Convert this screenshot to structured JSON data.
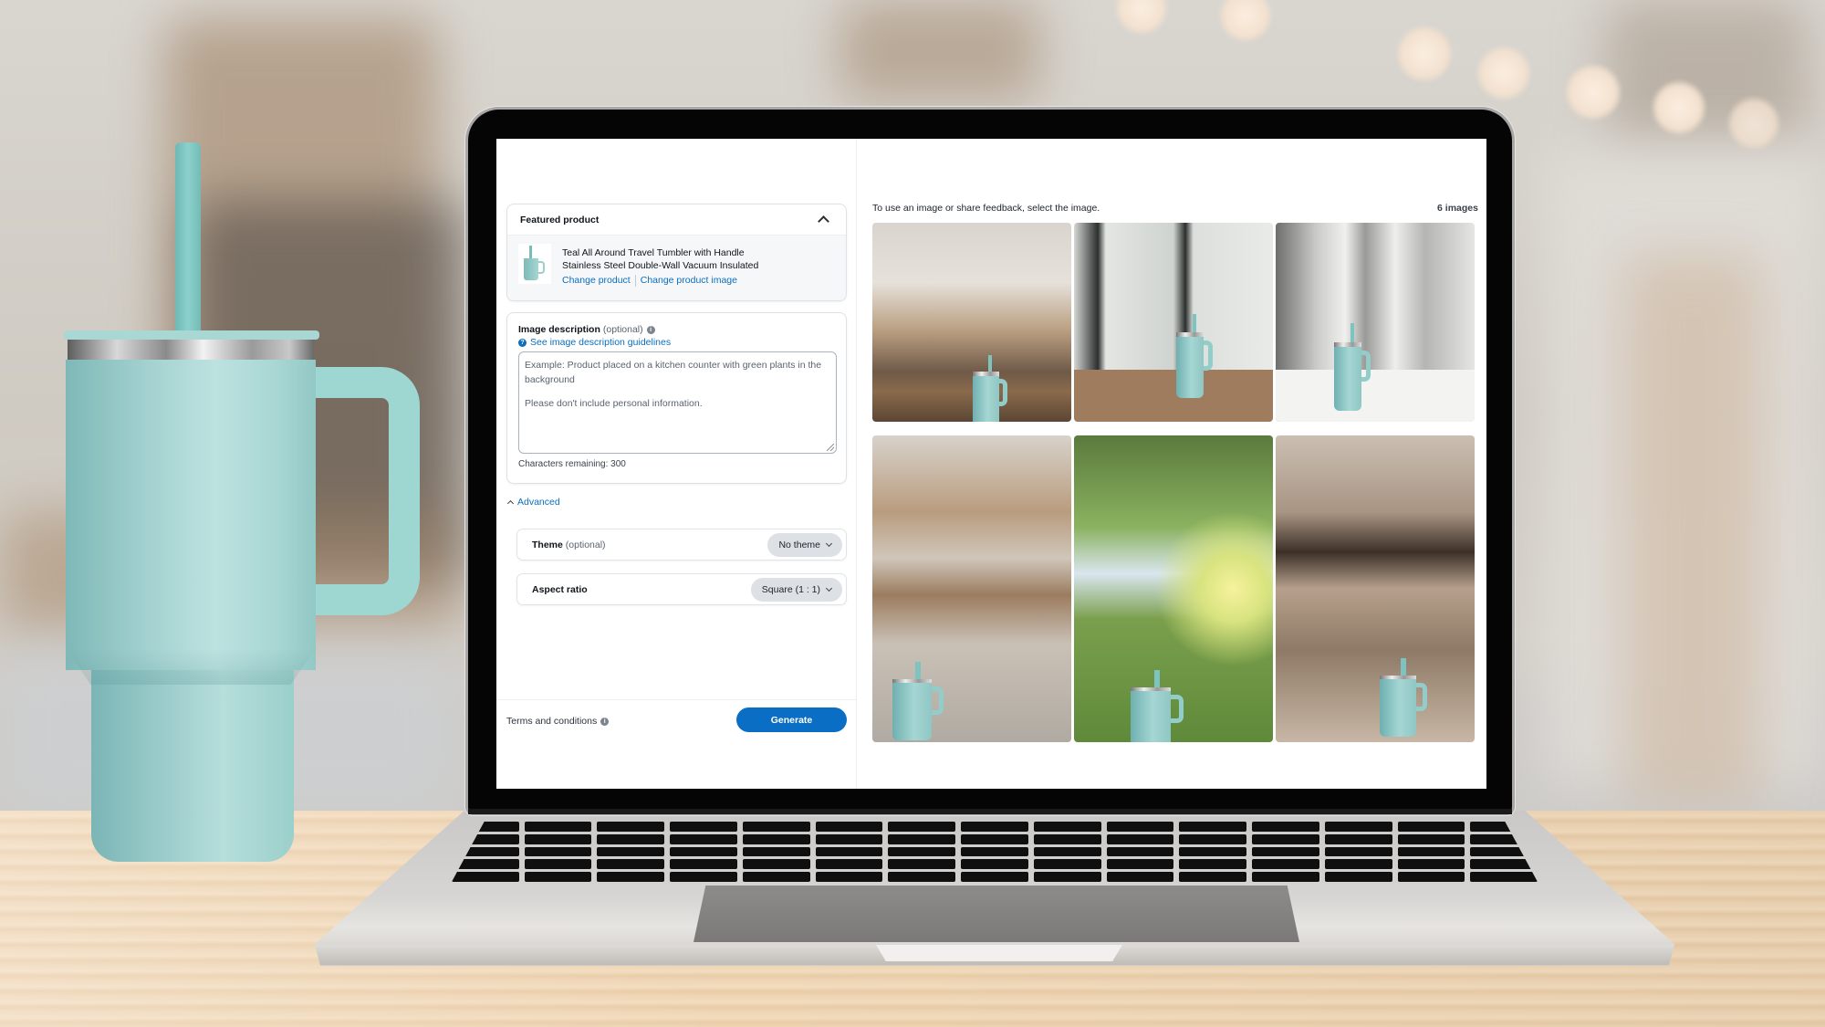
{
  "left_panel": {
    "featured_product": {
      "title": "Featured product",
      "product_name_line1": "Teal All Around Travel Tumbler with Handle",
      "product_name_line2": "Stainless Steel Double-Wall Vacuum Insulated",
      "change_product_label": "Change product",
      "change_image_label": "Change product image"
    },
    "image_description": {
      "label": "Image description",
      "optional": "(optional)",
      "guidelines_link": "See image description guidelines",
      "placeholder_line1": "Example: Product placed on a kitchen counter with green plants in the background",
      "placeholder_line2": "Please don't include personal information.",
      "value": "",
      "chars_remaining": "Characters remaining: 300"
    },
    "advanced": {
      "label": "Advanced",
      "theme": {
        "label": "Theme",
        "optional": "(optional)",
        "selected": "No theme"
      },
      "aspect_ratio": {
        "label": "Aspect ratio",
        "selected": "Square (1 : 1)"
      }
    },
    "footer": {
      "terms_label": "Terms and conditions",
      "generate_label": "Generate"
    }
  },
  "right_panel": {
    "hint": "To use an image or share feedback, select the image.",
    "count": "6 images",
    "images": [
      {
        "scene": "Rustic kitchen counter with shelves"
      },
      {
        "scene": "Cafe table with window background"
      },
      {
        "scene": "Bright restaurant white table"
      },
      {
        "scene": "Blurred wooden shelf interior"
      },
      {
        "scene": "Outdoor trees with sunlight"
      },
      {
        "scene": "Blurred cafe storefront"
      }
    ]
  },
  "colors": {
    "accent": "#0a6fc4",
    "link": "#0a6ebd",
    "product_teal": "#9ed6d1"
  }
}
